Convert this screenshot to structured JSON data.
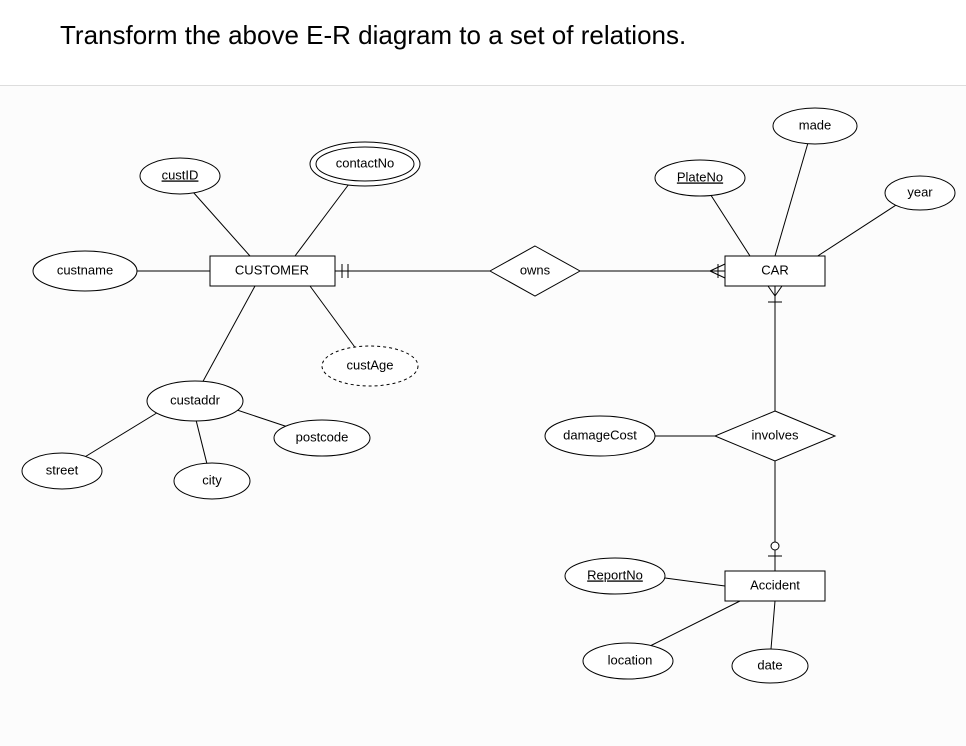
{
  "title": "Transform the above E-R diagram to a set of relations.",
  "entities": {
    "customer": "CUSTOMER",
    "car": "CAR",
    "accident": "Accident"
  },
  "relationships": {
    "owns": "owns",
    "involves": "involves"
  },
  "attributes": {
    "custID": "custID",
    "contactNo": "contactNo",
    "custname": "custname",
    "custaddr": "custaddr",
    "custAge": "custAge",
    "street": "street",
    "city": "city",
    "postcode": "postcode",
    "plateNo": "PlateNo",
    "made": "made",
    "year": "year",
    "damageCost": "damageCost",
    "reportNo": "ReportNo",
    "location": "location",
    "date": "date"
  }
}
